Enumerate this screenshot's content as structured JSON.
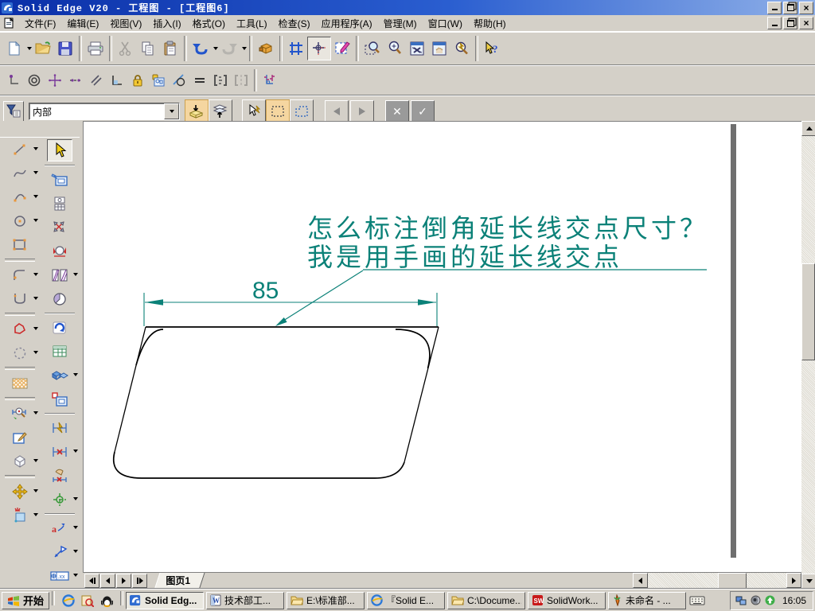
{
  "titlebar": {
    "title": "Solid Edge V20 - 工程图 - [工程图6]"
  },
  "menubar": {
    "items": [
      "文件(F)",
      "编辑(E)",
      "视图(V)",
      "插入(I)",
      "格式(O)",
      "工具(L)",
      "检查(S)",
      "应用程序(A)",
      "管理(M)",
      "窗口(W)",
      "帮助(H)"
    ]
  },
  "command_bar": {
    "filter_value": "内部"
  },
  "drawing": {
    "annotation_line1": "怎么标注倒角延长线交点尺寸？",
    "annotation_line2": "我是用手画的延长线交点",
    "dimension_value": "85",
    "colors": {
      "annotation": "#0b8178",
      "geometry": "#000000"
    }
  },
  "sheet_bar": {
    "active_tab": "图页1"
  },
  "taskbar": {
    "start_label": "开始",
    "tasks": [
      {
        "label": "Solid Edg...",
        "icon": "solid-edge",
        "active": true
      },
      {
        "label": "技术部工...",
        "icon": "word",
        "active": false
      },
      {
        "label": "E:\\标准部...",
        "icon": "folder",
        "active": false
      },
      {
        "label": "『Solid E...",
        "icon": "ie",
        "active": false
      },
      {
        "label": "C:\\Docume...",
        "icon": "folder",
        "active": false
      },
      {
        "label": "SolidWork...",
        "icon": "solidworks",
        "active": false
      },
      {
        "label": "未命名 - ...",
        "icon": "painter",
        "active": false
      }
    ],
    "clock": "16:05"
  }
}
